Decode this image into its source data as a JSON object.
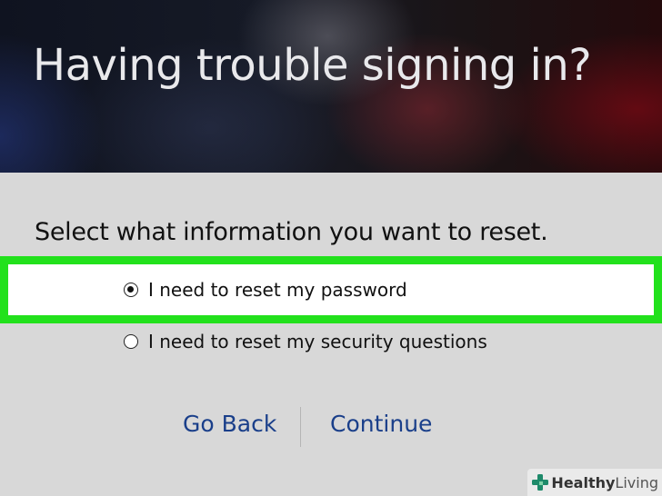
{
  "header": {
    "title": "Having trouble signing in?"
  },
  "form": {
    "prompt": "Select what information you want to reset.",
    "options": [
      {
        "label": "I need to reset my password",
        "selected": true
      },
      {
        "label": "I need to reset my security questions",
        "selected": false
      }
    ],
    "highlight_color": "#22e11c"
  },
  "actions": {
    "back_label": "Go Back",
    "continue_label": "Continue",
    "link_color": "#1a3f8a"
  },
  "watermark": {
    "brand_bold": "Healthy",
    "brand_light": "Living",
    "icon": "cross-icon",
    "icon_color": "#1e8a6a"
  }
}
